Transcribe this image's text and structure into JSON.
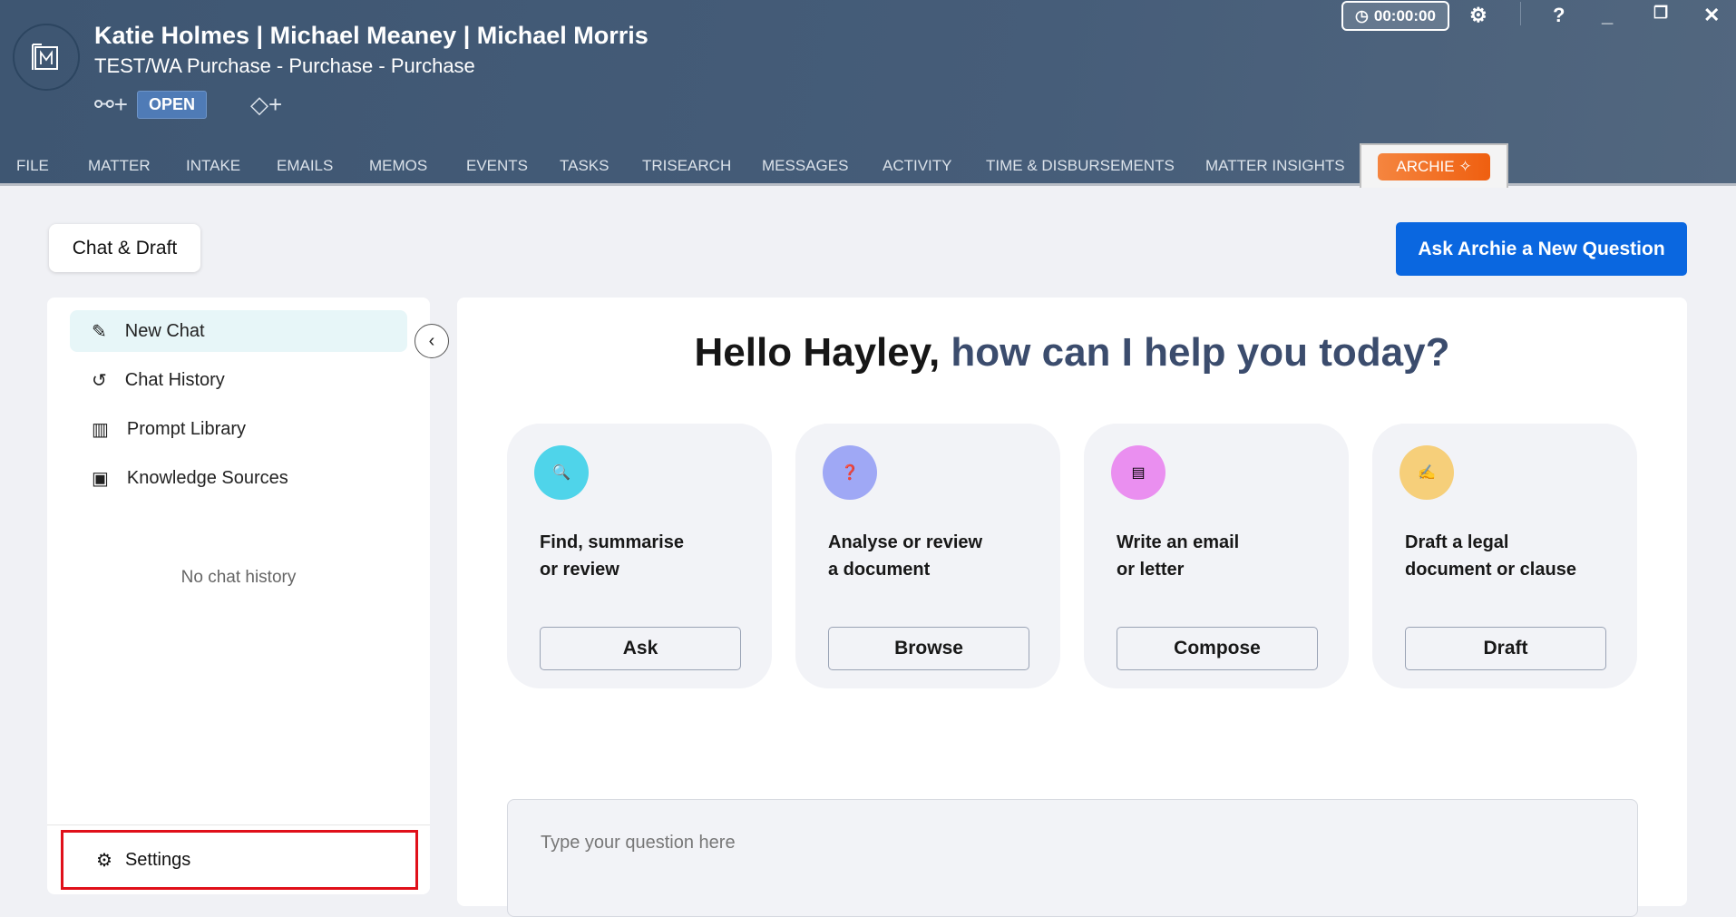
{
  "header": {
    "title": "Katie Holmes | Michael Meaney | Michael Morris",
    "subtitle": "TEST/WA Purchase - Purchase - Purchase",
    "status": "OPEN",
    "timer": "00:00:00"
  },
  "tabs": [
    "FILE",
    "MATTER",
    "INTAKE",
    "EMAILS",
    "MEMOS",
    "EVENTS",
    "TASKS",
    "TRISEARCH",
    "MESSAGES",
    "ACTIVITY",
    "TIME & DISBURSEMENTS",
    "MATTER INSIGHTS"
  ],
  "active_tab": "ARCHIE",
  "chat_draft": "Chat & Draft",
  "ask_button": "Ask Archie a New Question",
  "sidebar": {
    "items": [
      {
        "label": "New Chat"
      },
      {
        "label": "Chat History"
      },
      {
        "label": "Prompt Library"
      },
      {
        "label": "Knowledge Sources"
      }
    ],
    "empty": "No chat history",
    "settings": "Settings"
  },
  "main": {
    "greeting": "Hello Hayley,",
    "greeting_accent": "how can I help you today?",
    "cards": [
      {
        "line1": "Find, summarise",
        "line2": "or review",
        "button": "Ask",
        "color": "#4fd4ea"
      },
      {
        "line1": "Analyse or review",
        "line2": "a document",
        "button": "Browse",
        "color": "#9fa8f5"
      },
      {
        "line1": "Write an email",
        "line2": "or letter",
        "button": "Compose",
        "color": "#ea8ff0"
      },
      {
        "line1": "Draft a legal",
        "line2": "document or clause",
        "button": "Draft",
        "color": "#f6cf7a"
      }
    ],
    "input_placeholder": "Type your question here"
  }
}
